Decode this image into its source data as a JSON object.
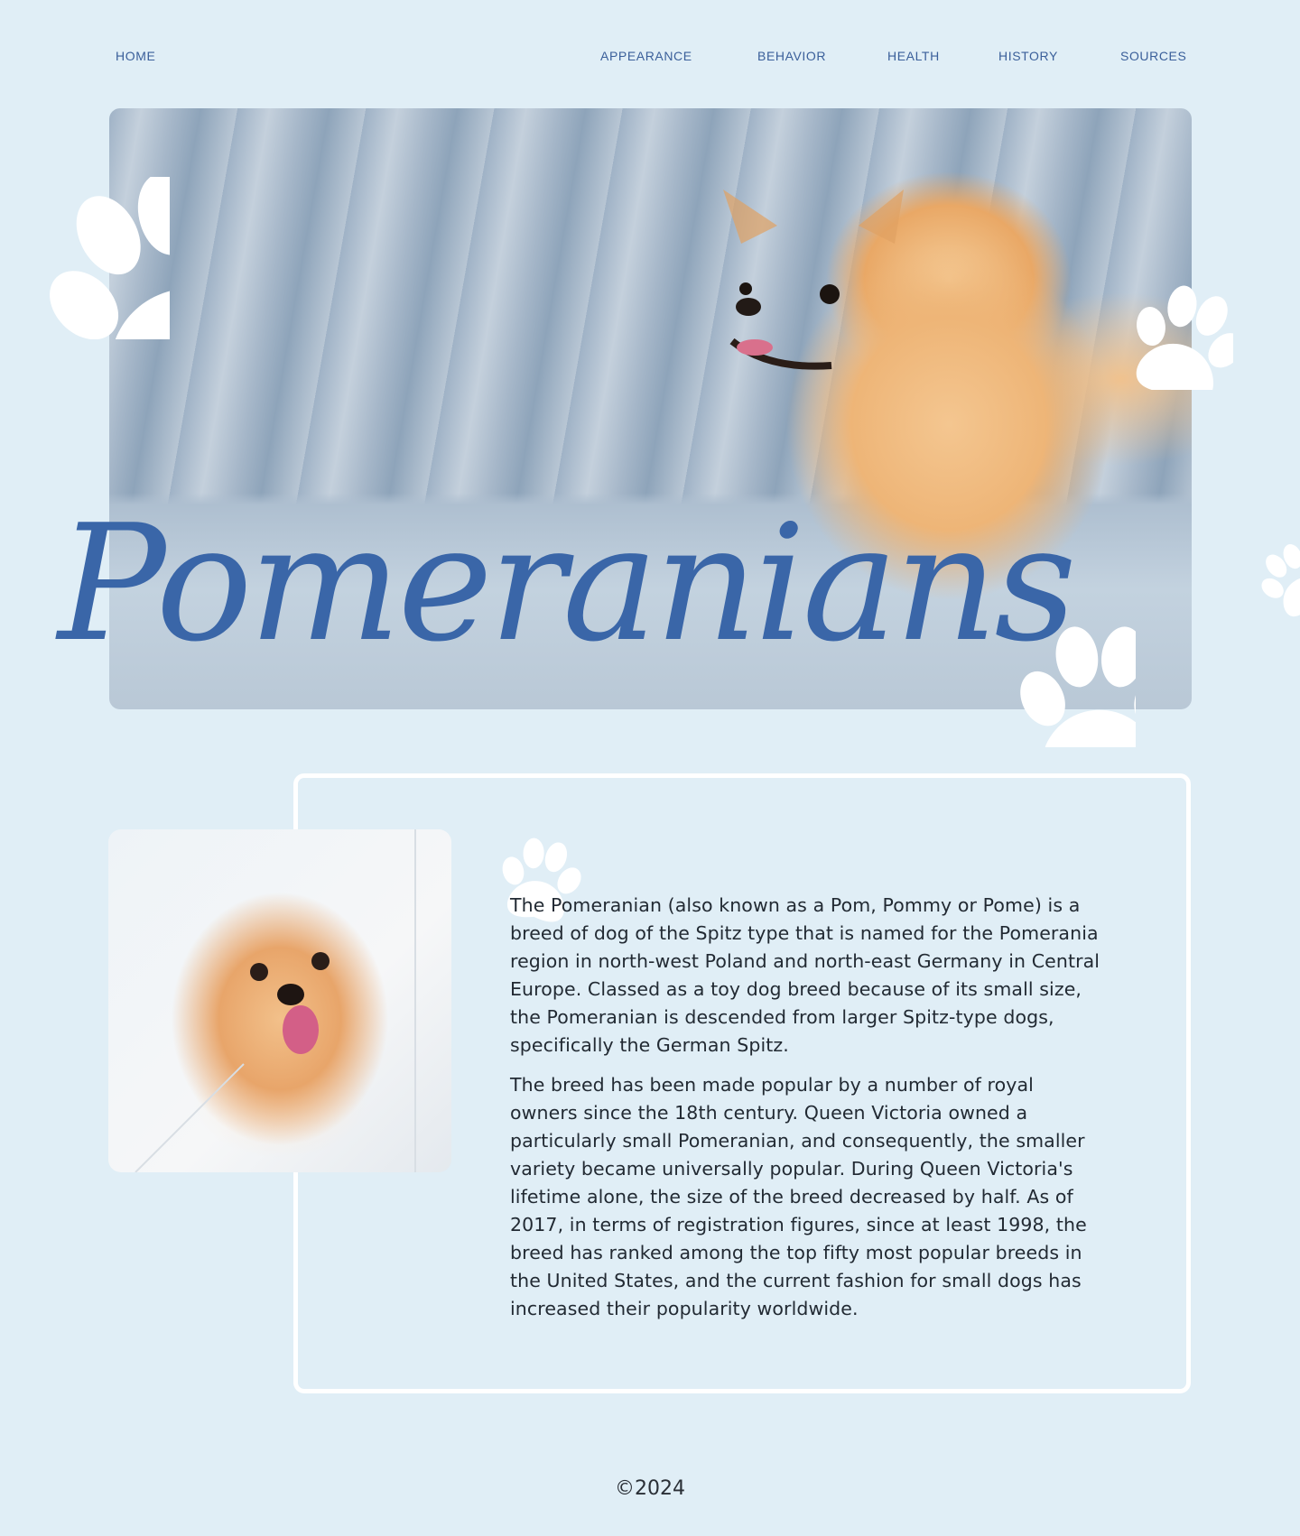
{
  "nav": {
    "home": "HOME",
    "appearance": "APPEARANCE",
    "behavior": "BEHAVIOR",
    "health": "HEALTH",
    "history": "HISTORY",
    "sources": "SOURCES"
  },
  "hero": {
    "title": "Pomeranians",
    "image_icon": "pomeranian-on-sofa-photo"
  },
  "content": {
    "image_icon": "pomeranian-smiling-photo",
    "paragraph1": "The Pomeranian (also known as a Pom, Pommy or Pome) is a breed of dog of the Spitz type that is named for the Pomerania region in north-west Poland and north-east Germany in Central Europe. Classed as a toy dog breed because of its small size, the Pomeranian is descended from larger Spitz-type dogs, specifically the German Spitz.",
    "paragraph2": "The breed has been made popular by a number of royal owners since the 18th century. Queen Victoria owned a particularly small Pomeranian, and consequently, the smaller variety became universally popular. During Queen Victoria's lifetime alone, the size of the breed decreased by half. As of 2017, in terms of registration figures, since at least 1998, the breed has ranked among the top fifty most popular breeds in the United States, and the current fashion for small dogs has increased their popularity worldwide."
  },
  "footer": {
    "copyright": "©2024"
  },
  "colors": {
    "background": "#e0eef6",
    "accent": "#3a66a8",
    "nav_text": "#3a5f9a",
    "card_border": "#ffffff"
  },
  "decorations": {
    "paw_icon": "paw-print-icon"
  }
}
